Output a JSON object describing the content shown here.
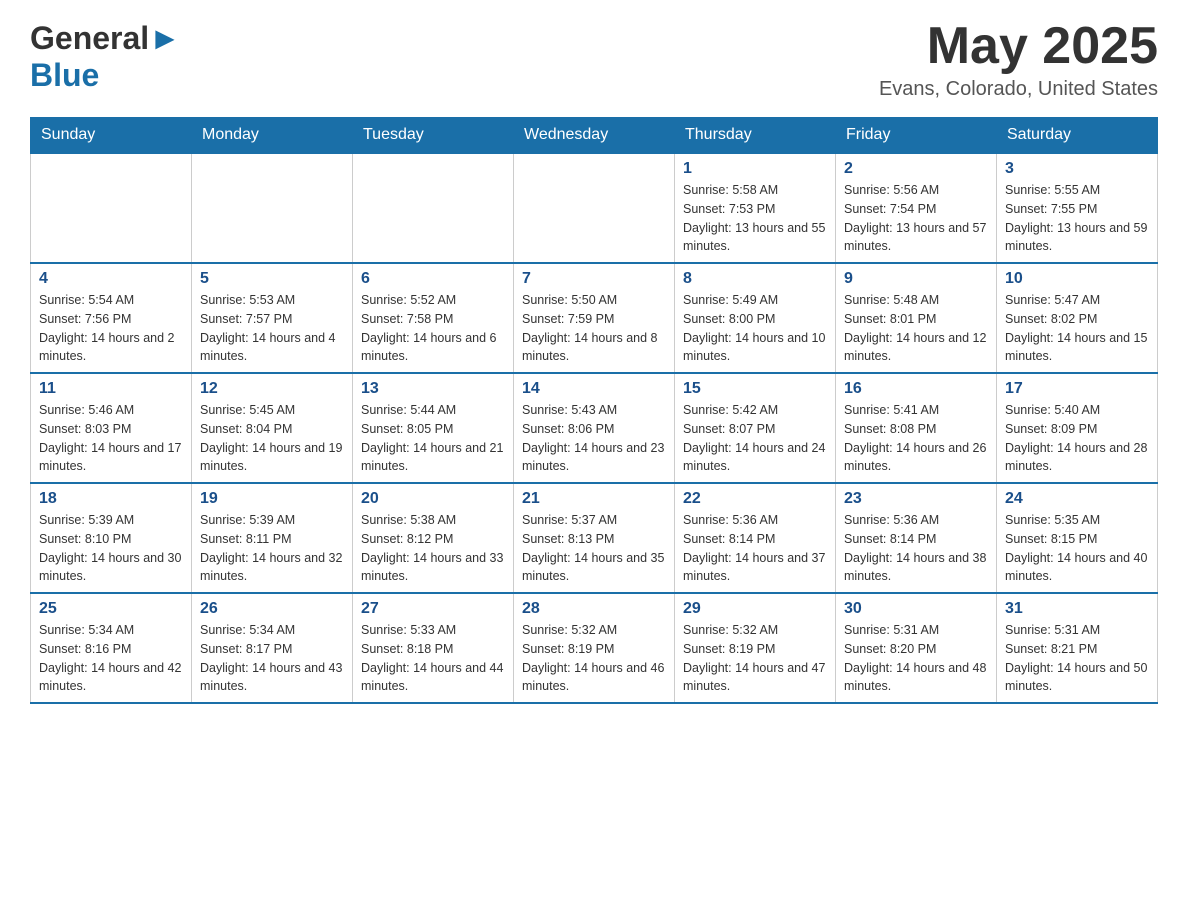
{
  "header": {
    "logo_general": "General",
    "logo_blue": "Blue",
    "month_year": "May 2025",
    "location": "Evans, Colorado, United States"
  },
  "days_of_week": [
    "Sunday",
    "Monday",
    "Tuesday",
    "Wednesday",
    "Thursday",
    "Friday",
    "Saturday"
  ],
  "weeks": [
    [
      {
        "day": "",
        "info": ""
      },
      {
        "day": "",
        "info": ""
      },
      {
        "day": "",
        "info": ""
      },
      {
        "day": "",
        "info": ""
      },
      {
        "day": "1",
        "info": "Sunrise: 5:58 AM\nSunset: 7:53 PM\nDaylight: 13 hours and 55 minutes."
      },
      {
        "day": "2",
        "info": "Sunrise: 5:56 AM\nSunset: 7:54 PM\nDaylight: 13 hours and 57 minutes."
      },
      {
        "day": "3",
        "info": "Sunrise: 5:55 AM\nSunset: 7:55 PM\nDaylight: 13 hours and 59 minutes."
      }
    ],
    [
      {
        "day": "4",
        "info": "Sunrise: 5:54 AM\nSunset: 7:56 PM\nDaylight: 14 hours and 2 minutes."
      },
      {
        "day": "5",
        "info": "Sunrise: 5:53 AM\nSunset: 7:57 PM\nDaylight: 14 hours and 4 minutes."
      },
      {
        "day": "6",
        "info": "Sunrise: 5:52 AM\nSunset: 7:58 PM\nDaylight: 14 hours and 6 minutes."
      },
      {
        "day": "7",
        "info": "Sunrise: 5:50 AM\nSunset: 7:59 PM\nDaylight: 14 hours and 8 minutes."
      },
      {
        "day": "8",
        "info": "Sunrise: 5:49 AM\nSunset: 8:00 PM\nDaylight: 14 hours and 10 minutes."
      },
      {
        "day": "9",
        "info": "Sunrise: 5:48 AM\nSunset: 8:01 PM\nDaylight: 14 hours and 12 minutes."
      },
      {
        "day": "10",
        "info": "Sunrise: 5:47 AM\nSunset: 8:02 PM\nDaylight: 14 hours and 15 minutes."
      }
    ],
    [
      {
        "day": "11",
        "info": "Sunrise: 5:46 AM\nSunset: 8:03 PM\nDaylight: 14 hours and 17 minutes."
      },
      {
        "day": "12",
        "info": "Sunrise: 5:45 AM\nSunset: 8:04 PM\nDaylight: 14 hours and 19 minutes."
      },
      {
        "day": "13",
        "info": "Sunrise: 5:44 AM\nSunset: 8:05 PM\nDaylight: 14 hours and 21 minutes."
      },
      {
        "day": "14",
        "info": "Sunrise: 5:43 AM\nSunset: 8:06 PM\nDaylight: 14 hours and 23 minutes."
      },
      {
        "day": "15",
        "info": "Sunrise: 5:42 AM\nSunset: 8:07 PM\nDaylight: 14 hours and 24 minutes."
      },
      {
        "day": "16",
        "info": "Sunrise: 5:41 AM\nSunset: 8:08 PM\nDaylight: 14 hours and 26 minutes."
      },
      {
        "day": "17",
        "info": "Sunrise: 5:40 AM\nSunset: 8:09 PM\nDaylight: 14 hours and 28 minutes."
      }
    ],
    [
      {
        "day": "18",
        "info": "Sunrise: 5:39 AM\nSunset: 8:10 PM\nDaylight: 14 hours and 30 minutes."
      },
      {
        "day": "19",
        "info": "Sunrise: 5:39 AM\nSunset: 8:11 PM\nDaylight: 14 hours and 32 minutes."
      },
      {
        "day": "20",
        "info": "Sunrise: 5:38 AM\nSunset: 8:12 PM\nDaylight: 14 hours and 33 minutes."
      },
      {
        "day": "21",
        "info": "Sunrise: 5:37 AM\nSunset: 8:13 PM\nDaylight: 14 hours and 35 minutes."
      },
      {
        "day": "22",
        "info": "Sunrise: 5:36 AM\nSunset: 8:14 PM\nDaylight: 14 hours and 37 minutes."
      },
      {
        "day": "23",
        "info": "Sunrise: 5:36 AM\nSunset: 8:14 PM\nDaylight: 14 hours and 38 minutes."
      },
      {
        "day": "24",
        "info": "Sunrise: 5:35 AM\nSunset: 8:15 PM\nDaylight: 14 hours and 40 minutes."
      }
    ],
    [
      {
        "day": "25",
        "info": "Sunrise: 5:34 AM\nSunset: 8:16 PM\nDaylight: 14 hours and 42 minutes."
      },
      {
        "day": "26",
        "info": "Sunrise: 5:34 AM\nSunset: 8:17 PM\nDaylight: 14 hours and 43 minutes."
      },
      {
        "day": "27",
        "info": "Sunrise: 5:33 AM\nSunset: 8:18 PM\nDaylight: 14 hours and 44 minutes."
      },
      {
        "day": "28",
        "info": "Sunrise: 5:32 AM\nSunset: 8:19 PM\nDaylight: 14 hours and 46 minutes."
      },
      {
        "day": "29",
        "info": "Sunrise: 5:32 AM\nSunset: 8:19 PM\nDaylight: 14 hours and 47 minutes."
      },
      {
        "day": "30",
        "info": "Sunrise: 5:31 AM\nSunset: 8:20 PM\nDaylight: 14 hours and 48 minutes."
      },
      {
        "day": "31",
        "info": "Sunrise: 5:31 AM\nSunset: 8:21 PM\nDaylight: 14 hours and 50 minutes."
      }
    ]
  ]
}
